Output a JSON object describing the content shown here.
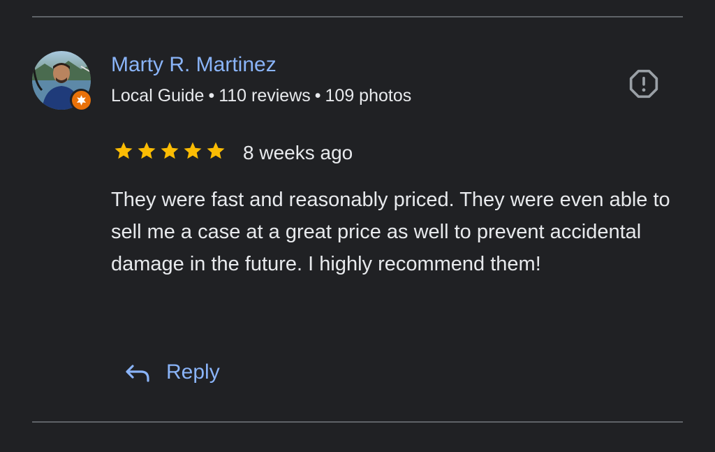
{
  "review": {
    "author": {
      "name": "Marty R. Martinez",
      "badge_icon": "local-guide-star-icon",
      "local_guide_label": "Local Guide",
      "reviews_count": "110 reviews",
      "photos_count": "109 photos",
      "separator": "•"
    },
    "rating": 5,
    "max_rating": 5,
    "time_ago": "8 weeks ago",
    "text": "They were fast and reasonably priced. They were even able to sell me a case at a great price as well to prevent accidental damage in the future. I highly recommend them!",
    "actions": {
      "reply_label": "Reply",
      "reply_icon": "reply-arrow-icon",
      "report_icon": "report-octagon-icon"
    }
  },
  "colors": {
    "background": "#202124",
    "link_blue": "#8ab4f8",
    "text": "#e8eaed",
    "star": "#fbbc04",
    "badge_orange": "#e8710a",
    "divider": "#5f6368",
    "icon_gray": "#9aa0a6"
  }
}
